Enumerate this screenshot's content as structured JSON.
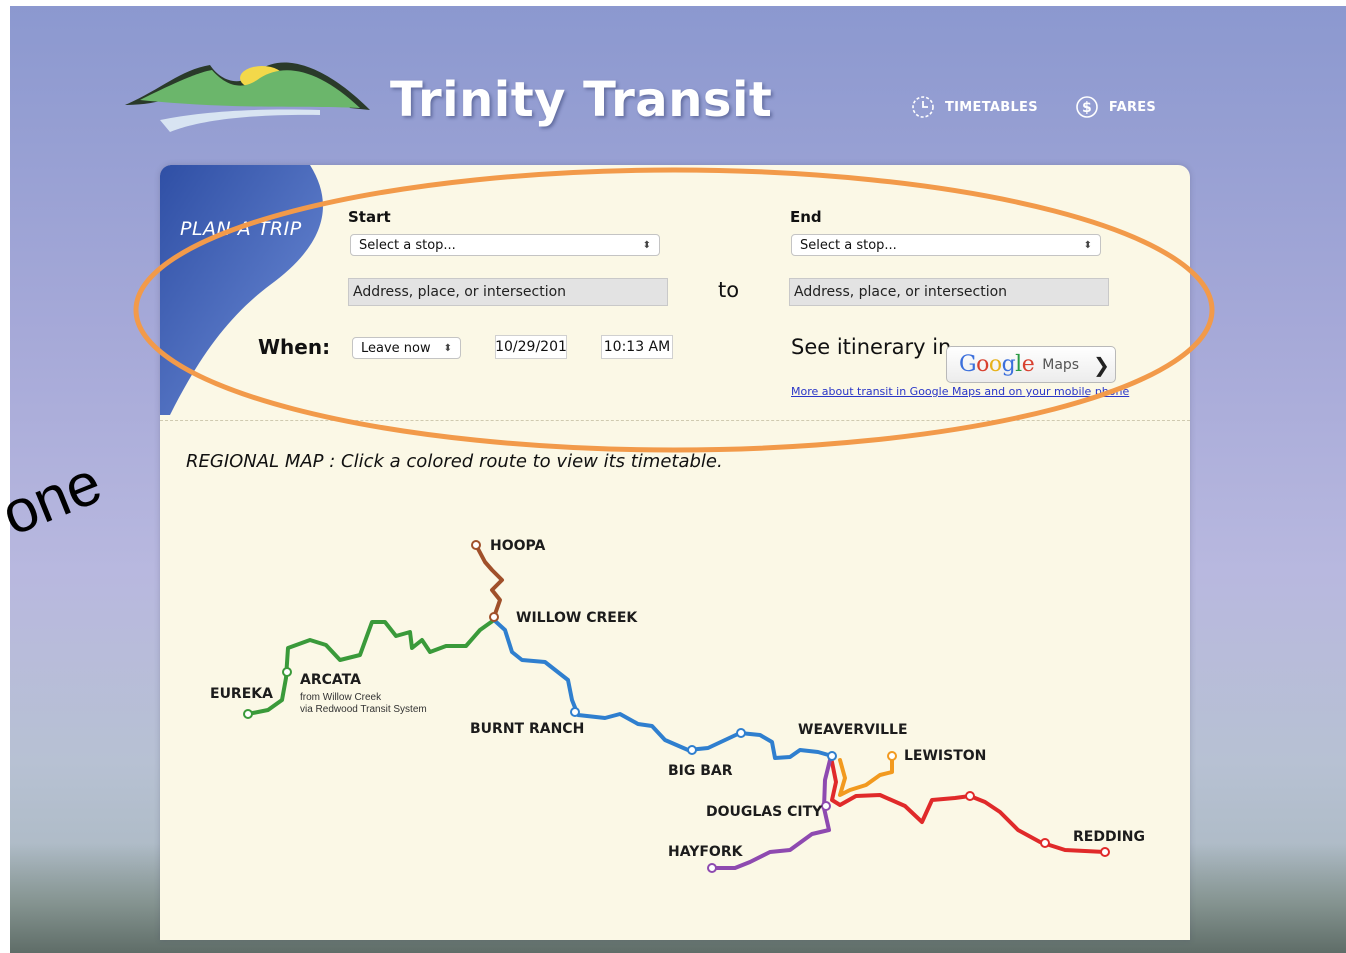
{
  "brand": {
    "title": "Trinity Transit"
  },
  "nav": {
    "timetables": "TIMETABLES",
    "fares": "FARES"
  },
  "plan": {
    "label": "PLAN A TRIP",
    "start_label": "Start",
    "end_label": "End",
    "start_select": "Select a stop...",
    "end_select": "Select a stop...",
    "start_address": "Address, place, or intersection",
    "end_address": "Address, place, or intersection",
    "to_text": "to",
    "when_label": "When:",
    "when_option": "Leave now",
    "date_value": "10/29/201",
    "time_value": "10:13 AM",
    "itinerary_text": "See itinerary in",
    "google_word": "Google",
    "maps_word": "Maps",
    "more_link": "More about transit in Google Maps and on your mobile phone"
  },
  "map": {
    "instruction": "REGIONAL MAP : Click a colored route to view its timetable.",
    "cities": {
      "hoopa": "HOOPA",
      "willow_creek": "WILLOW CREEK",
      "arcata": "ARCATA",
      "arcata_note_1": "from Willow Creek",
      "arcata_note_2": "via Redwood Transit System",
      "eureka": "EUREKA",
      "burnt_ranch": "BURNT RANCH",
      "big_bar": "BIG BAR",
      "weaverville": "WEAVERVILLE",
      "lewiston": "LEWISTON",
      "douglas_city": "DOUGLAS CITY",
      "hayfork": "HAYFORK",
      "redding": "REDDING"
    },
    "route_colors": {
      "hoopa": "#a0502a",
      "arcata": "#3a9a3a",
      "weaverville": "#2f7fcf",
      "lewiston": "#f29a1f",
      "redding": "#e02a2a",
      "hayfork": "#8e4ab0"
    }
  },
  "annotation": {
    "text": "one",
    "ellipse_color": "#f29a4a"
  }
}
